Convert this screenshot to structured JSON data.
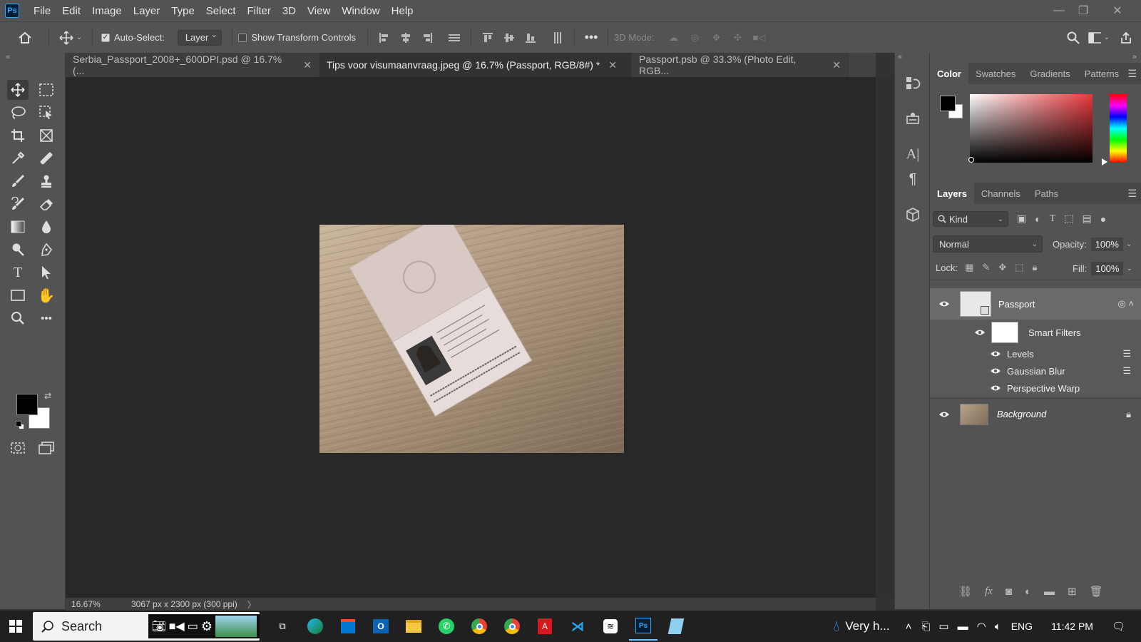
{
  "app": {
    "logo_text": "Ps"
  },
  "menu": [
    "File",
    "Edit",
    "Image",
    "Layer",
    "Type",
    "Select",
    "Filter",
    "3D",
    "View",
    "Window",
    "Help"
  ],
  "options": {
    "auto_select_label": "Auto-Select:",
    "auto_select_checked": true,
    "layer_select": "Layer",
    "show_transform_label": "Show Transform Controls",
    "show_transform_checked": false,
    "three_d_mode_label": "3D Mode:"
  },
  "tabs": [
    {
      "label": "Serbia_Passport_2008+_600DPI.psd @ 16.7% (...",
      "active": false
    },
    {
      "label": "Tips voor visumaanvraag.jpeg @ 16.7% (Passport, RGB/8#) *",
      "active": true
    },
    {
      "label": "Passport.psb @ 33.3% (Photo Edit, RGB...",
      "active": false
    }
  ],
  "status": {
    "zoom": "16.67%",
    "doc_info": "3067 px x 2300 px (300 ppi)",
    "arrow": "〉"
  },
  "color_panel": {
    "tabs": [
      "Color",
      "Swatches",
      "Gradients",
      "Patterns"
    ],
    "active_tab": "Color",
    "foreground": "#000000",
    "background": "#ffffff",
    "hue_color": "#ff0000"
  },
  "layers_panel": {
    "tabs": [
      "Layers",
      "Channels",
      "Paths"
    ],
    "active_tab": "Layers",
    "filter_kind": "Kind",
    "blend_mode": "Normal",
    "opacity_label": "Opacity:",
    "opacity_value": "100%",
    "lock_label": "Lock:",
    "fill_label": "Fill:",
    "fill_value": "100%",
    "layers": [
      {
        "name": "Passport",
        "smart_object": true
      },
      {
        "name": "Smart Filters"
      },
      {
        "name": "Levels"
      },
      {
        "name": "Gaussian Blur"
      },
      {
        "name": "Perspective Warp"
      },
      {
        "name": "Background",
        "locked": true
      }
    ]
  },
  "taskbar": {
    "search_text": "Search",
    "weather": "Very h...",
    "language": "ENG",
    "time": "11:42 PM"
  },
  "colors": {
    "accent": "#31a8ff",
    "panel": "#535353",
    "canvas": "#282828"
  }
}
